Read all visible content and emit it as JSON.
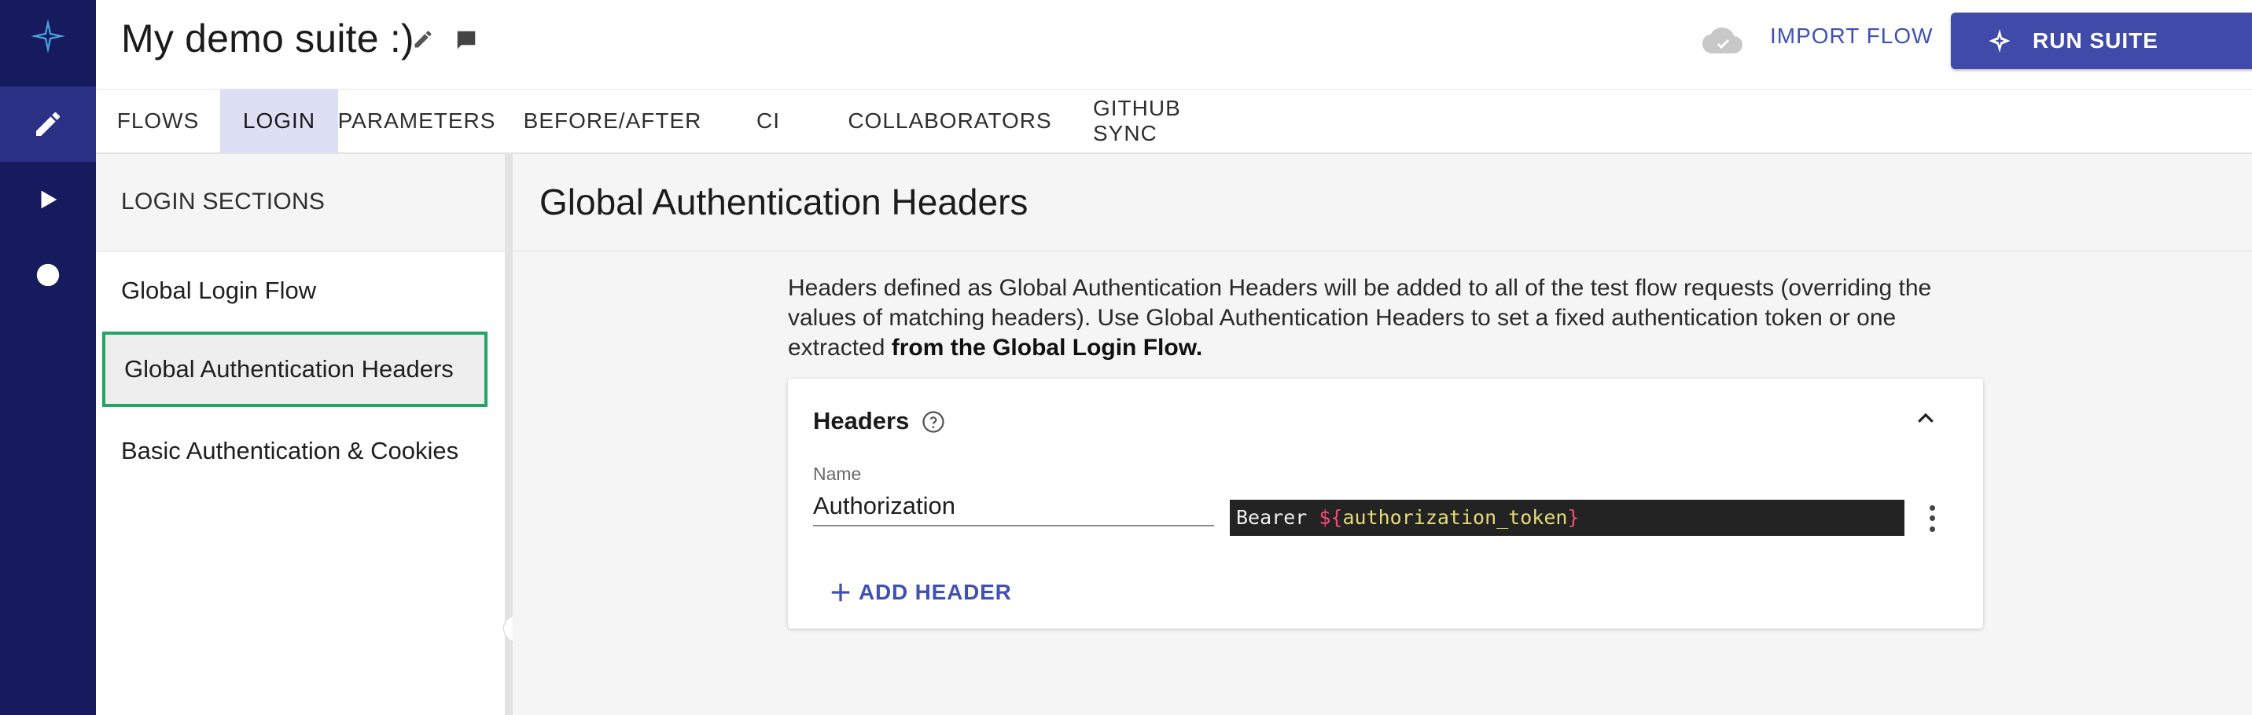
{
  "suite": {
    "title": "My demo suite :)"
  },
  "header": {
    "import_label": "IMPORT FLOW",
    "run_label": "RUN SUITE"
  },
  "tabs": [
    {
      "label": "FLOWS",
      "active": false
    },
    {
      "label": "LOGIN",
      "active": true
    },
    {
      "label": "PARAMETERS",
      "active": false
    },
    {
      "label": "BEFORE/AFTER",
      "active": false
    },
    {
      "label": "CI",
      "active": false
    },
    {
      "label": "COLLABORATORS",
      "active": false
    },
    {
      "label": "GITHUB SYNC",
      "active": false
    }
  ],
  "sections": {
    "title": "LOGIN SECTIONS",
    "items": [
      {
        "label": "Global Login Flow",
        "active": false
      },
      {
        "label": "Global Authentication Headers",
        "active": true
      },
      {
        "label": "Basic Authentication & Cookies",
        "active": false
      }
    ]
  },
  "main": {
    "title": "Global Authentication Headers",
    "description_text": "Headers defined as Global Authentication Headers will be added to all of the test flow requests (overriding the values of matching headers). Use Global Authentication Headers to set a fixed authentication token or one extracted ",
    "description_bold": "from the Global Login Flow.",
    "card": {
      "title": "Headers",
      "name_label": "Name",
      "header_name": "Authorization",
      "value_prefix": "Bearer ",
      "value_dollar_open": "${",
      "value_variable": "authorization_token",
      "value_close": "}",
      "add_label": "ADD HEADER"
    }
  },
  "icons": {
    "rail": [
      "logo-icon",
      "edit-icon",
      "play-icon",
      "circle-icon"
    ],
    "header": [
      "pencil-icon",
      "comment-icon",
      "cloud-icon",
      "run-icon",
      "caret-down-icon"
    ]
  },
  "colors": {
    "rail": "#151b5c",
    "accent": "#3f51b5",
    "selected_outline": "#22a565",
    "active_tab": "#dde0f4"
  }
}
